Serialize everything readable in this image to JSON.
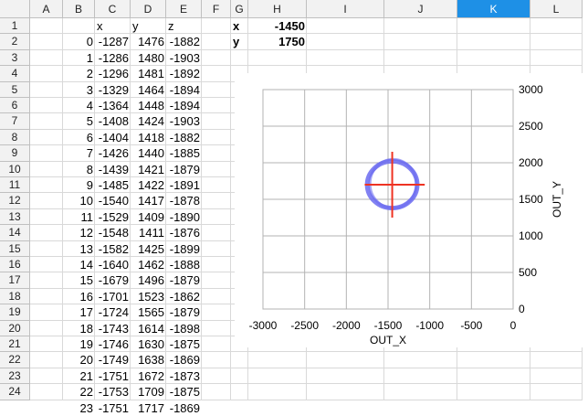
{
  "columns": [
    {
      "label": "A",
      "width": 36,
      "selected": false
    },
    {
      "label": "B",
      "width": 35,
      "selected": false
    },
    {
      "label": "C",
      "width": 39,
      "selected": false
    },
    {
      "label": "D",
      "width": 39,
      "selected": false
    },
    {
      "label": "E",
      "width": 39,
      "selected": false
    },
    {
      "label": "F",
      "width": 32,
      "selected": false
    },
    {
      "label": "G",
      "width": 19,
      "selected": false
    },
    {
      "label": "H",
      "width": 64,
      "selected": false
    },
    {
      "label": "I",
      "width": 85,
      "selected": false
    },
    {
      "label": "J",
      "width": 80,
      "selected": false
    },
    {
      "label": "K",
      "width": 80,
      "selected": true
    },
    {
      "label": "L",
      "width": 57,
      "selected": false
    }
  ],
  "rows": [
    "1",
    "2",
    "3",
    "4",
    "5",
    "6",
    "7",
    "8",
    "9",
    "10",
    "11",
    "12",
    "13",
    "14",
    "15",
    "16",
    "17",
    "18",
    "19",
    "20",
    "21",
    "22",
    "23",
    "24"
  ],
  "headers": {
    "x": "x",
    "y": "y",
    "z": "z"
  },
  "data": [
    [
      0,
      -1287,
      1476,
      -1882
    ],
    [
      1,
      -1286,
      1480,
      -1903
    ],
    [
      2,
      -1296,
      1481,
      -1892
    ],
    [
      3,
      -1329,
      1464,
      -1894
    ],
    [
      4,
      -1364,
      1448,
      -1894
    ],
    [
      5,
      -1408,
      1424,
      -1903
    ],
    [
      6,
      -1404,
      1418,
      -1882
    ],
    [
      7,
      -1426,
      1440,
      -1885
    ],
    [
      8,
      -1439,
      1421,
      -1879
    ],
    [
      9,
      -1485,
      1422,
      -1891
    ],
    [
      10,
      -1540,
      1417,
      -1878
    ],
    [
      11,
      -1529,
      1409,
      -1890
    ],
    [
      12,
      -1548,
      1411,
      -1876
    ],
    [
      13,
      -1582,
      1425,
      -1899
    ],
    [
      14,
      -1640,
      1462,
      -1888
    ],
    [
      15,
      -1679,
      1496,
      -1879
    ],
    [
      16,
      -1701,
      1523,
      -1862
    ],
    [
      17,
      -1724,
      1565,
      -1879
    ],
    [
      18,
      -1743,
      1614,
      -1898
    ],
    [
      19,
      -1746,
      1630,
      -1875
    ],
    [
      20,
      -1749,
      1638,
      -1869
    ],
    [
      21,
      -1751,
      1672,
      -1873
    ],
    [
      22,
      -1753,
      1709,
      -1875
    ],
    [
      23,
      -1751,
      1717,
      -1869
    ]
  ],
  "params": [
    {
      "label": "x",
      "value": "-1450"
    },
    {
      "label": "y",
      "value": "1750"
    }
  ],
  "chart_data": {
    "type": "scatter",
    "xlabel": "OUT_X",
    "ylabel": "OUT_Y",
    "xlim": [
      -3000,
      0
    ],
    "ylim": [
      0,
      3000
    ],
    "xticks": [
      "-3000",
      "-2500",
      "-2000",
      "-1500",
      "-1000",
      "-500",
      "0"
    ],
    "yticks": [
      "0",
      "500",
      "1000",
      "1500",
      "2000",
      "2500",
      "3000"
    ],
    "grid": true,
    "circle": {
      "cx": -1450,
      "cy": 1700,
      "rx": 300,
      "ry": 320,
      "color": "#6b6bf0"
    },
    "crosshair": {
      "x": -1450,
      "y": 1700,
      "x_range": [
        -1780,
        -1060
      ],
      "y_range": [
        1250,
        2150
      ],
      "color": "#ee3322"
    }
  }
}
